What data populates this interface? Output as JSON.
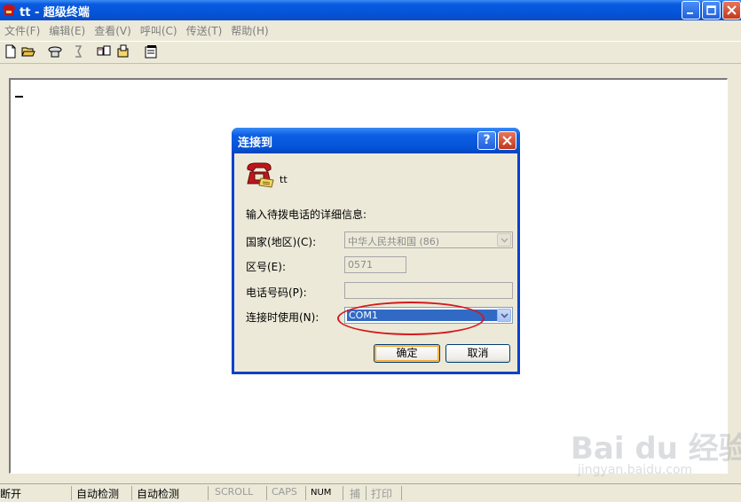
{
  "window": {
    "title": "tt - 超级终端",
    "icon": "phone-app-icon"
  },
  "menu": [
    "文件(F)",
    "编辑(E)",
    "查看(V)",
    "呼叫(C)",
    "传送(T)",
    "帮助(H)"
  ],
  "toolbar": {
    "icons": [
      "new-icon",
      "open-icon",
      "call-icon",
      "disconnect-icon",
      "send-icon",
      "receive-icon",
      "properties-icon"
    ]
  },
  "dialog": {
    "title": "连接到",
    "connection_name": "tt",
    "prompt": "输入待拨电话的详细信息:",
    "country_label": "国家(地区)(C):",
    "country_value": "中华人民共和国 (86)",
    "area_label": "区号(E):",
    "area_value": "0571",
    "phone_label": "电话号码(P):",
    "phone_value": "",
    "connect_using_label": "连接时使用(N):",
    "connect_using_value": "COM1",
    "ok_label": "确定",
    "cancel_label": "取消"
  },
  "status": {
    "connection": "断开",
    "detect1": "自动检测",
    "detect2": "自动检测",
    "scroll": "SCROLL",
    "caps": "CAPS",
    "num": "NUM",
    "capture": "捕",
    "print": "打印"
  },
  "watermark": {
    "main": "Bai du 经验",
    "sub": "jingyan.baidu.com"
  },
  "colors": {
    "title_blue": "#0453d6",
    "selection": "#316ac5",
    "annotation_red": "#d3191d"
  }
}
